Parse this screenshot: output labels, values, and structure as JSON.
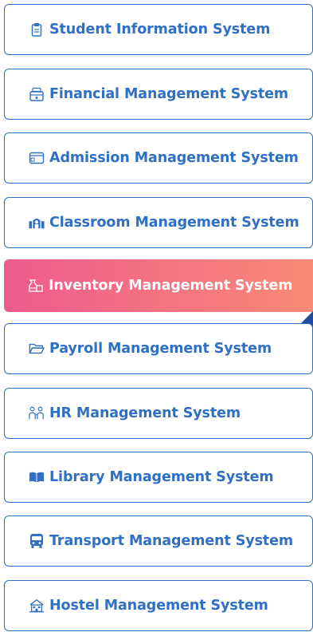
{
  "menu": {
    "items": [
      {
        "label": "Student Information System",
        "icon": "clipboard-icon",
        "active": false
      },
      {
        "label": "Financial Management System",
        "icon": "finance-icon",
        "active": false
      },
      {
        "label": "Admission Management System",
        "icon": "window-icon",
        "active": false
      },
      {
        "label": "Classroom Management System",
        "icon": "classroom-icon",
        "active": false
      },
      {
        "label": "Inventory Management System",
        "icon": "inventory-icon",
        "active": true
      },
      {
        "label": "Payroll Management System",
        "icon": "folder-icon",
        "active": false
      },
      {
        "label": "HR Management System",
        "icon": "people-icon",
        "active": false
      },
      {
        "label": "Library Management System",
        "icon": "book-icon",
        "active": false
      },
      {
        "label": "Transport Management System",
        "icon": "bus-icon",
        "active": false
      },
      {
        "label": "Hostel Management System",
        "icon": "hostel-icon",
        "active": false
      }
    ]
  },
  "colors": {
    "accent": "#2f6fc4",
    "active_gradient_start": "#ee5b8d",
    "active_gradient_end": "#f98a76",
    "notch": "#1f4ea0"
  }
}
